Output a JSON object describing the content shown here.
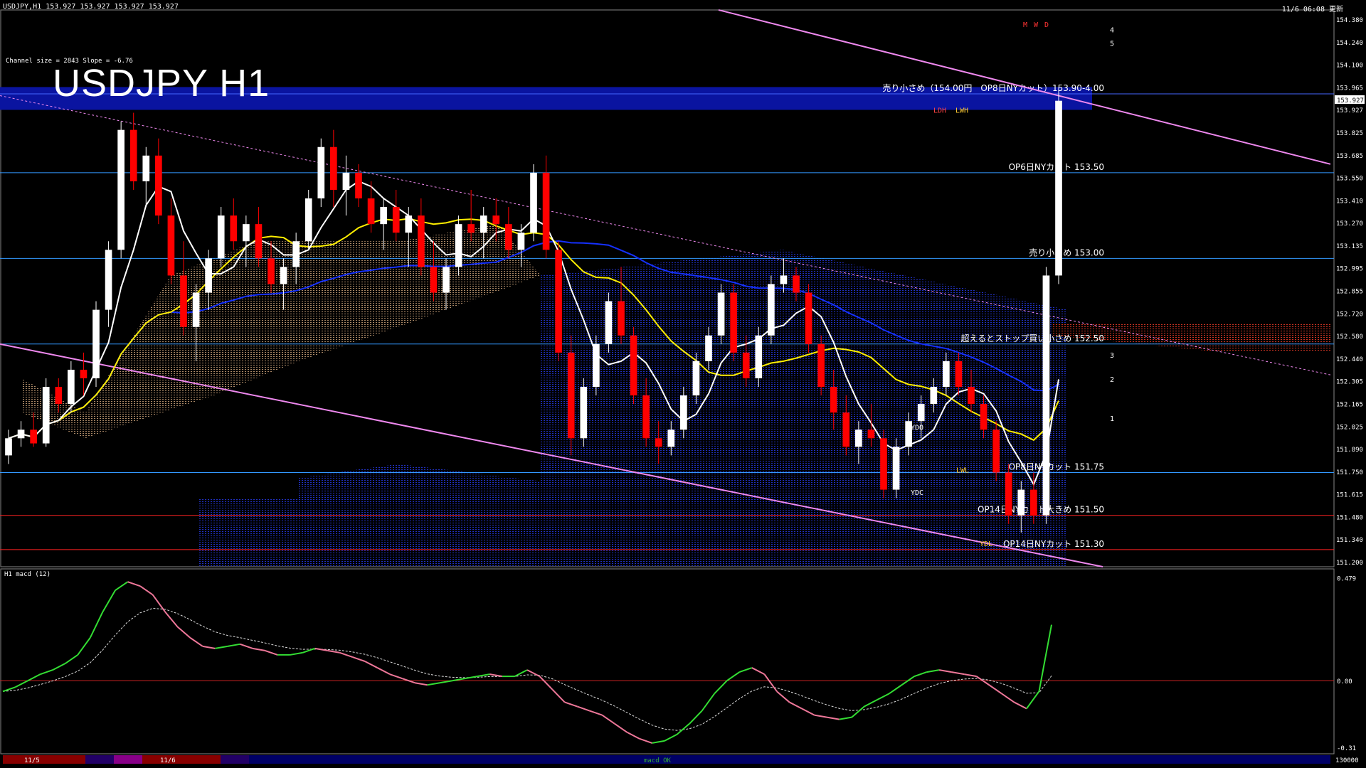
{
  "header": {
    "symbol_info": "USDJPY,H1  153.927 153.927 153.927 153.927",
    "server_time": "11/6 06:08 更新",
    "channel_info": "Channel size = 2843 Slope = -6.76",
    "big_title": "USDJPY H1"
  },
  "colors": {
    "background": "#000000",
    "bull": "#ffffff",
    "bear": "#ff0000",
    "blue_band": "#0a14a0",
    "channel": "#ee88ee",
    "macd": "#33dd33",
    "macd_down": "#ee7799",
    "ma_fast": "#ffffff",
    "ma_mid": "#ffee00",
    "ma_slow": "#1530ff",
    "cloud": "#2030c0"
  },
  "price_axis": {
    "labels": [
      "154.380",
      "154.240",
      "154.100",
      "153.965",
      "153.927",
      "153.825",
      "153.685",
      "153.550",
      "153.410",
      "153.270",
      "153.135",
      "152.995",
      "152.855",
      "152.720",
      "152.580",
      "152.440",
      "152.305",
      "152.165",
      "152.025",
      "151.890",
      "151.750",
      "151.615",
      "151.480",
      "151.340",
      "151.200"
    ],
    "current_price": "153.927"
  },
  "macd_panel": {
    "title": "H1  macd (12)",
    "labels": [
      "0.479",
      "0.00",
      "-0.31"
    ]
  },
  "levels": [
    {
      "price": 153.96,
      "label": "売り小さめ（154.00円　OP8日NYカット）153.90-4.00",
      "color": "#4466ff"
    },
    {
      "price": 153.5,
      "label": "OP6日NYカット 153.50",
      "color": "#3399ff"
    },
    {
      "price": 153.0,
      "label": "売り小さめ 153.00",
      "color": "#3399ff"
    },
    {
      "price": 152.5,
      "label": "超えるとストップ買い小さめ 152.50",
      "color": "#3399ff"
    },
    {
      "price": 151.75,
      "label": "OP8日NYカット 151.75",
      "color": "#3399ff"
    },
    {
      "price": 151.5,
      "label": "OP14日NYカット大きめ 151.50",
      "color": "#ff2222"
    },
    {
      "price": 151.3,
      "label": "OP14日NYカット 151.30",
      "color": "#ff2222"
    }
  ],
  "markers": {
    "ydo": "YDO",
    "ydc": "YDC",
    "ydl": "YDL",
    "lwl": "LWL",
    "lwh": "LWH",
    "ldh": "LDH",
    "mwd": [
      "M",
      "W",
      "D"
    ],
    "fib": [
      "4",
      "5",
      "3",
      "2",
      "1"
    ]
  },
  "time_axis": {
    "dates": [
      "11/5",
      "11/6"
    ],
    "right_value": "130000",
    "center_label": "macd OK"
  },
  "chart_data": {
    "type": "candlestick",
    "title": "USDJPY H1",
    "ylim": [
      151.2,
      154.45
    ],
    "candles_ohlc": [
      [
        151.85,
        152.0,
        151.8,
        151.95
      ],
      [
        151.95,
        152.05,
        151.9,
        152.0
      ],
      [
        152.0,
        152.1,
        151.9,
        151.92
      ],
      [
        151.92,
        152.3,
        151.9,
        152.25
      ],
      [
        152.25,
        152.3,
        152.1,
        152.15
      ],
      [
        152.15,
        152.4,
        152.1,
        152.35
      ],
      [
        152.35,
        152.45,
        152.2,
        152.3
      ],
      [
        152.3,
        152.75,
        152.25,
        152.7
      ],
      [
        152.7,
        153.1,
        152.6,
        153.05
      ],
      [
        153.05,
        153.8,
        153.0,
        153.75
      ],
      [
        153.75,
        153.85,
        153.4,
        153.45
      ],
      [
        153.45,
        153.65,
        153.3,
        153.6
      ],
      [
        153.6,
        153.7,
        153.2,
        153.25
      ],
      [
        153.25,
        153.35,
        152.85,
        152.9
      ],
      [
        152.9,
        153.1,
        152.55,
        152.6
      ],
      [
        152.6,
        152.85,
        152.4,
        152.8
      ],
      [
        152.8,
        153.05,
        152.7,
        153.0
      ],
      [
        153.0,
        153.3,
        152.95,
        153.25
      ],
      [
        153.25,
        153.35,
        153.05,
        153.1
      ],
      [
        153.1,
        153.25,
        152.95,
        153.2
      ],
      [
        153.2,
        153.3,
        152.95,
        153.0
      ],
      [
        153.0,
        153.1,
        152.8,
        152.85
      ],
      [
        152.85,
        153.0,
        152.7,
        152.95
      ],
      [
        152.95,
        153.15,
        152.85,
        153.1
      ],
      [
        153.1,
        153.4,
        153.05,
        153.35
      ],
      [
        153.35,
        153.7,
        153.3,
        153.65
      ],
      [
        153.65,
        153.75,
        153.3,
        153.4
      ],
      [
        153.4,
        153.6,
        153.25,
        153.5
      ],
      [
        153.5,
        153.55,
        153.3,
        153.35
      ],
      [
        153.35,
        153.45,
        153.15,
        153.2
      ],
      [
        153.2,
        153.35,
        153.05,
        153.3
      ],
      [
        153.3,
        153.4,
        153.1,
        153.15
      ],
      [
        153.15,
        153.3,
        152.95,
        153.25
      ],
      [
        153.25,
        153.35,
        152.9,
        152.95
      ],
      [
        152.95,
        153.1,
        152.75,
        152.8
      ],
      [
        152.8,
        153.0,
        152.7,
        152.95
      ],
      [
        152.95,
        153.25,
        152.9,
        153.2
      ],
      [
        153.2,
        153.4,
        153.1,
        153.15
      ],
      [
        153.15,
        153.3,
        153.0,
        153.25
      ],
      [
        153.25,
        153.35,
        153.1,
        153.2
      ],
      [
        153.2,
        153.3,
        153.0,
        153.05
      ],
      [
        153.05,
        153.2,
        152.95,
        153.15
      ],
      [
        153.15,
        153.55,
        153.1,
        153.5
      ],
      [
        153.5,
        153.6,
        153.0,
        153.05
      ],
      [
        153.05,
        153.1,
        152.4,
        152.45
      ],
      [
        152.45,
        152.55,
        151.85,
        151.95
      ],
      [
        151.95,
        152.3,
        151.9,
        152.25
      ],
      [
        152.25,
        152.55,
        152.2,
        152.5
      ],
      [
        152.5,
        152.8,
        152.45,
        152.75
      ],
      [
        152.75,
        152.95,
        152.5,
        152.55
      ],
      [
        152.55,
        152.6,
        152.15,
        152.2
      ],
      [
        152.2,
        152.3,
        151.9,
        151.95
      ],
      [
        151.95,
        152.05,
        151.8,
        151.9
      ],
      [
        151.9,
        152.05,
        151.85,
        152.0
      ],
      [
        152.0,
        152.25,
        151.95,
        152.2
      ],
      [
        152.2,
        152.45,
        152.15,
        152.4
      ],
      [
        152.4,
        152.6,
        152.35,
        152.55
      ],
      [
        152.55,
        152.85,
        152.5,
        152.8
      ],
      [
        152.8,
        152.85,
        152.4,
        152.45
      ],
      [
        152.45,
        152.55,
        152.25,
        152.3
      ],
      [
        152.3,
        152.6,
        152.25,
        152.55
      ],
      [
        152.55,
        152.9,
        152.5,
        152.85
      ],
      [
        152.85,
        153.0,
        152.8,
        152.9
      ],
      [
        152.9,
        152.95,
        152.75,
        152.8
      ],
      [
        152.8,
        152.85,
        152.45,
        152.5
      ],
      [
        152.5,
        152.55,
        152.2,
        152.25
      ],
      [
        152.25,
        152.35,
        152.0,
        152.1
      ],
      [
        152.1,
        152.2,
        151.85,
        151.9
      ],
      [
        151.9,
        152.05,
        151.8,
        152.0
      ],
      [
        152.0,
        152.15,
        151.9,
        151.95
      ],
      [
        151.95,
        152.0,
        151.6,
        151.65
      ],
      [
        151.65,
        151.95,
        151.6,
        151.9
      ],
      [
        151.9,
        152.1,
        151.85,
        152.05
      ],
      [
        152.05,
        152.2,
        151.95,
        152.15
      ],
      [
        152.15,
        152.3,
        152.1,
        152.25
      ],
      [
        152.25,
        152.45,
        152.2,
        152.4
      ],
      [
        152.4,
        152.45,
        152.2,
        152.25
      ],
      [
        152.25,
        152.35,
        152.1,
        152.15
      ],
      [
        152.15,
        152.2,
        151.95,
        152.0
      ],
      [
        152.0,
        152.05,
        151.7,
        151.75
      ],
      [
        151.75,
        151.8,
        151.45,
        151.5
      ],
      [
        151.5,
        151.7,
        151.4,
        151.65
      ],
      [
        151.65,
        151.75,
        151.45,
        151.5
      ],
      [
        151.5,
        152.95,
        151.45,
        152.9
      ],
      [
        152.9,
        154.0,
        152.85,
        153.92
      ]
    ],
    "macd_line": [
      -0.05,
      -0.03,
      0.0,
      0.03,
      0.05,
      0.08,
      0.12,
      0.2,
      0.32,
      0.42,
      0.46,
      0.44,
      0.4,
      0.32,
      0.25,
      0.2,
      0.16,
      0.15,
      0.16,
      0.17,
      0.15,
      0.14,
      0.12,
      0.12,
      0.13,
      0.15,
      0.14,
      0.13,
      0.11,
      0.09,
      0.06,
      0.03,
      0.01,
      -0.01,
      -0.02,
      -0.01,
      0.0,
      0.01,
      0.02,
      0.03,
      0.02,
      0.02,
      0.05,
      0.02,
      -0.04,
      -0.1,
      -0.12,
      -0.14,
      -0.16,
      -0.2,
      -0.24,
      -0.27,
      -0.29,
      -0.28,
      -0.25,
      -0.2,
      -0.14,
      -0.06,
      0.0,
      0.04,
      0.06,
      0.03,
      -0.05,
      -0.1,
      -0.13,
      -0.16,
      -0.17,
      -0.18,
      -0.17,
      -0.12,
      -0.09,
      -0.06,
      -0.02,
      0.02,
      0.04,
      0.05,
      0.04,
      0.03,
      0.02,
      -0.02,
      -0.06,
      -0.1,
      -0.13,
      -0.05,
      0.26
    ],
    "series": [
      {
        "name": "macd (12)",
        "values_ref": "macd_line"
      }
    ]
  }
}
